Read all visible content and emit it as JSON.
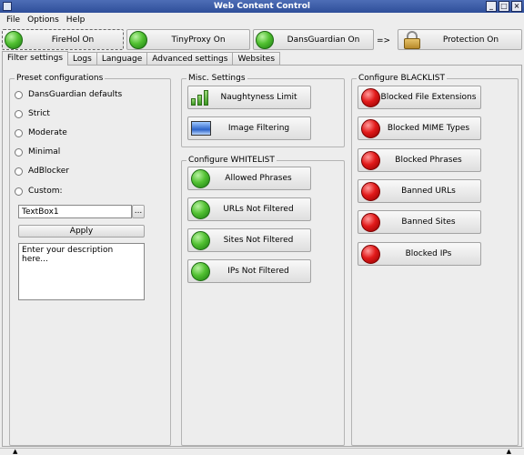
{
  "window": {
    "title": "Web Content Control"
  },
  "menu": {
    "file": "File",
    "options": "Options",
    "help": "Help"
  },
  "toolbar": {
    "firehol": "FireHol On",
    "tinyproxy": "TinyProxy On",
    "dansguardian": "DansGuardian On",
    "arrow": "=>",
    "protection": "Protection On"
  },
  "tabs": [
    "Filter settings",
    "Logs",
    "Language",
    "Advanced settings",
    "Websites"
  ],
  "preset": {
    "title": "Preset configurations",
    "options": [
      "DansGuardian defaults",
      "Strict",
      "Moderate",
      "Minimal",
      "AdBlocker",
      "Custom:"
    ],
    "textbox_value": "TextBox1",
    "browse_label": "...",
    "apply_label": "Apply",
    "description": "Enter your description here..."
  },
  "misc": {
    "title": "Misc. Settings",
    "naughtyness": "Naughtyness Limit",
    "image_filtering": "Image Filtering"
  },
  "whitelist": {
    "title": "Configure WHITELIST",
    "items": [
      "Allowed Phrases",
      "URLs Not Filtered",
      "Sites Not Filtered",
      "IPs Not Filtered"
    ]
  },
  "blacklist": {
    "title": "Configure BLACKLIST",
    "items": [
      "Blocked File Extensions",
      "Blocked MIME Types",
      "Blocked Phrases",
      "Banned URLs",
      "Banned Sites",
      "Blocked IPs"
    ]
  },
  "statusbar": {
    "left": "▲",
    "right": "▲"
  }
}
